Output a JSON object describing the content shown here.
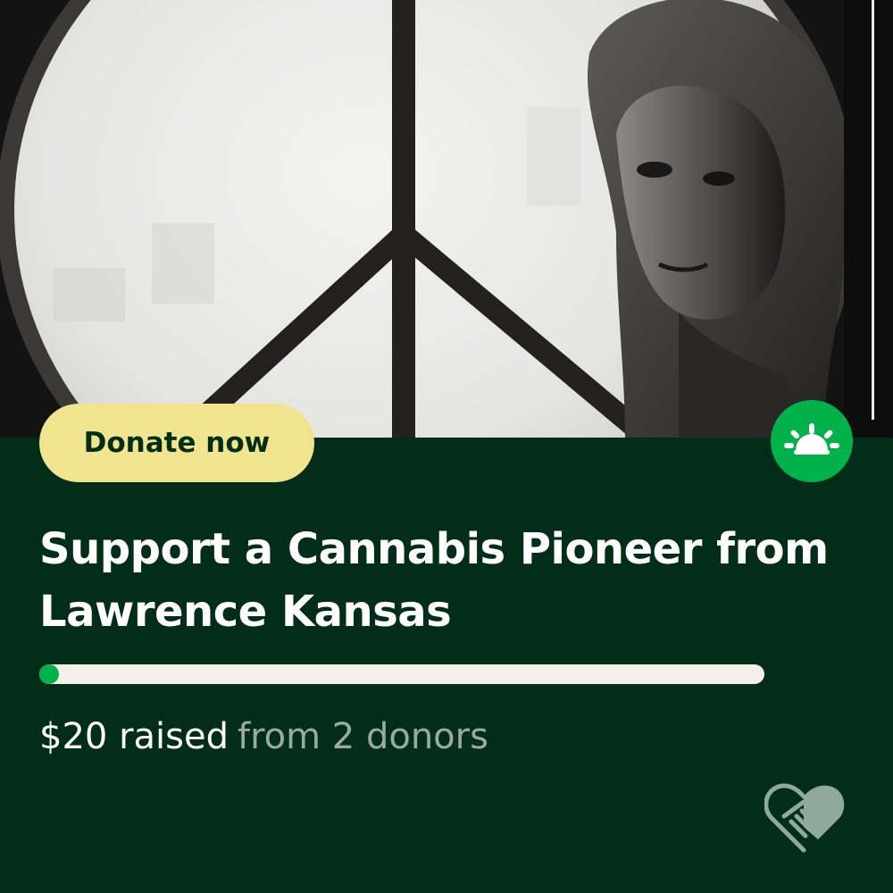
{
  "campaign": {
    "title": "Support a Cannabis Pioneer from Lawrence Kansas",
    "donate_label": "Donate now",
    "raised_label": "$20 raised",
    "donors_label": "from 2 donors",
    "progress_fraction": 0.02
  },
  "icons": {
    "brand": "gofundme-sprout-icon",
    "footer": "heart-handshake-icon"
  },
  "colors": {
    "background": "#012d19",
    "accent_green": "#01b14a",
    "donate_button": "#f1e48f",
    "progress_track": "#f4f1ea",
    "muted_text": "#9aaa9f"
  }
}
